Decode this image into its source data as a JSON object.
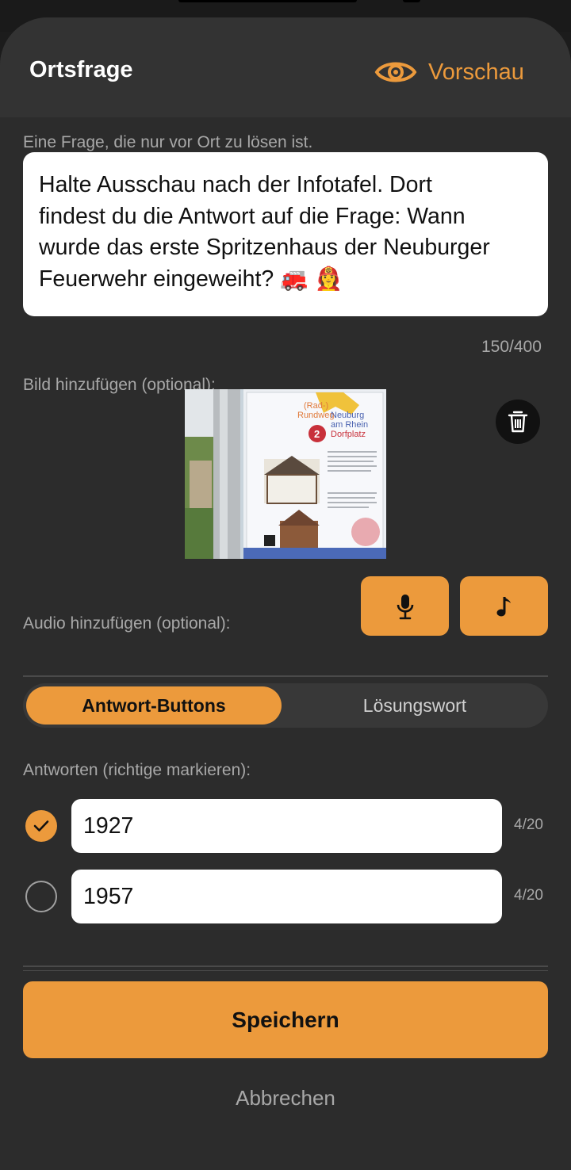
{
  "header": {
    "title": "Ortsfrage",
    "preview_label": "Vorschau"
  },
  "question": {
    "hint": "Eine Frage, die nur vor Ort zu lösen ist.",
    "line1": "Halte Ausschau nach der Infotafel. Dort",
    "line2": "findest du die Antwort auf die Frage: Wann",
    "line3": "wurde das erste Spritzenhaus der Neuburger",
    "line4": "Feuerwehr eingeweiht? 🚒 👩‍🚒",
    "counter": "150/400"
  },
  "image": {
    "label": "Bild hinzufügen (optional):",
    "sign_line1": "(Rad-)",
    "sign_line2": "Rundweg",
    "sign_line3": "Neuburg",
    "sign_line4": "am Rhein",
    "sign_number": "2",
    "sign_line5": "Dorfplatz"
  },
  "audio": {
    "label": "Audio hinzufügen (optional):",
    "mic_icon": "microphone-icon",
    "music_icon": "music-note-icon"
  },
  "mode": {
    "active": "Antwort-Buttons",
    "inactive": "Lösungswort"
  },
  "answers": {
    "label": "Antworten (richtige markieren):",
    "items": [
      {
        "value": "1927",
        "count": "4/20",
        "correct": true
      },
      {
        "value": "1957",
        "count": "4/20",
        "correct": false
      }
    ]
  },
  "actions": {
    "save": "Speichern",
    "cancel": "Abbrechen"
  },
  "colors": {
    "accent": "#ec9a3c",
    "background": "#2c2c2c",
    "header": "#333333"
  }
}
